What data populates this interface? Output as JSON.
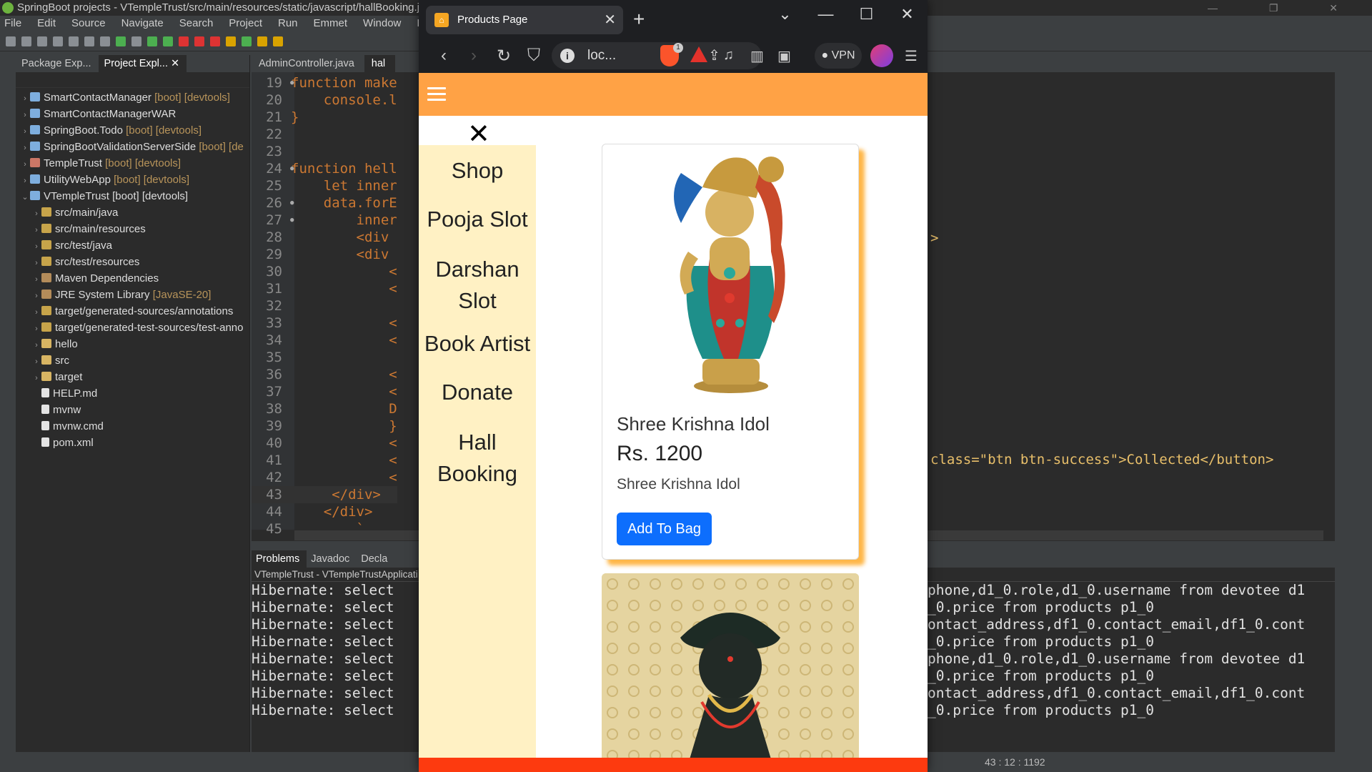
{
  "ide": {
    "title": "SpringBoot projects - VTempleTrust/src/main/resources/static/javascript/hallBooking.js - Sp",
    "menu": [
      "File",
      "Edit",
      "Source",
      "Navigate",
      "Search",
      "Project",
      "Run",
      "Emmet",
      "Window",
      "Help"
    ],
    "panel_tabs": [
      "Package Exp...",
      "Project Expl..."
    ],
    "tree": [
      {
        "name": "SmartContactManager",
        "dec": " [boot] [devtools]",
        "kind": "proj",
        "arrow": "›"
      },
      {
        "name": "SmartContactManagerWAR",
        "dec": "",
        "kind": "proj",
        "arrow": "›"
      },
      {
        "name": "SpringBoot.Todo",
        "dec": " [boot] [devtools]",
        "kind": "proj",
        "arrow": "›"
      },
      {
        "name": "SpringBootValidationServerSide",
        "dec": " [boot] [de",
        "kind": "proj",
        "arrow": "›"
      },
      {
        "name": "TempleTrust",
        "dec": " [boot] [devtools]",
        "kind": "proj err",
        "arrow": "›"
      },
      {
        "name": "UtilityWebApp",
        "dec": " [boot] [devtools]",
        "kind": "proj",
        "arrow": "›"
      },
      {
        "name": "VTempleTrust [boot] [devtools]",
        "dec": "",
        "kind": "proj",
        "arrow": "⌄"
      },
      {
        "name": "src/main/java",
        "dec": "",
        "kind": "src",
        "arrow": "›",
        "indent": 1
      },
      {
        "name": "src/main/resources",
        "dec": "",
        "kind": "src",
        "arrow": "›",
        "indent": 1
      },
      {
        "name": "src/test/java",
        "dec": "",
        "kind": "src",
        "arrow": "›",
        "indent": 1
      },
      {
        "name": "src/test/resources",
        "dec": "",
        "kind": "src",
        "arrow": "›",
        "indent": 1
      },
      {
        "name": "Maven Dependencies",
        "dec": "",
        "kind": "lib",
        "arrow": "›",
        "indent": 1
      },
      {
        "name": "JRE System Library",
        "dec": " [JavaSE-20]",
        "kind": "lib",
        "arrow": "›",
        "indent": 1
      },
      {
        "name": "target/generated-sources/annotations",
        "dec": "",
        "kind": "src",
        "arrow": "›",
        "indent": 1
      },
      {
        "name": "target/generated-test-sources/test-anno",
        "dec": "",
        "kind": "src",
        "arrow": "›",
        "indent": 1
      },
      {
        "name": "hello",
        "dec": "",
        "kind": "fold",
        "arrow": "›",
        "indent": 1
      },
      {
        "name": "src",
        "dec": "",
        "kind": "fold",
        "arrow": "›",
        "indent": 1
      },
      {
        "name": "target",
        "dec": "",
        "kind": "fold",
        "arrow": "›",
        "indent": 1
      },
      {
        "name": "HELP.md",
        "dec": "",
        "kind": "file",
        "arrow": "",
        "indent": 1
      },
      {
        "name": "mvnw",
        "dec": "",
        "kind": "file",
        "arrow": "",
        "indent": 1
      },
      {
        "name": "mvnw.cmd",
        "dec": "",
        "kind": "file",
        "arrow": "",
        "indent": 1
      },
      {
        "name": "pom.xml",
        "dec": "",
        "kind": "file",
        "arrow": "",
        "indent": 1
      }
    ],
    "editor_tabs": [
      "AdminController.java",
      "hal"
    ],
    "code_lines": [
      {
        "n": "19",
        "bp": true,
        "t": "function make"
      },
      {
        "n": "20",
        "bp": false,
        "t": "    console.l"
      },
      {
        "n": "21",
        "bp": false,
        "t": "}"
      },
      {
        "n": "22",
        "bp": false,
        "t": ""
      },
      {
        "n": "23",
        "bp": false,
        "t": ""
      },
      {
        "n": "24",
        "bp": true,
        "t": "function hell"
      },
      {
        "n": "25",
        "bp": false,
        "t": "    let inner"
      },
      {
        "n": "26",
        "bp": true,
        "t": "    data.forE"
      },
      {
        "n": "27",
        "bp": true,
        "t": "        inner"
      },
      {
        "n": "28",
        "bp": false,
        "t": "        <div "
      },
      {
        "n": "29",
        "bp": false,
        "t": "        <div "
      },
      {
        "n": "30",
        "bp": false,
        "t": "            <"
      },
      {
        "n": "31",
        "bp": false,
        "t": "            <"
      },
      {
        "n": "32",
        "bp": false,
        "t": ""
      },
      {
        "n": "33",
        "bp": false,
        "t": "            <"
      },
      {
        "n": "34",
        "bp": false,
        "t": "            <"
      },
      {
        "n": "35",
        "bp": false,
        "t": ""
      },
      {
        "n": "36",
        "bp": false,
        "t": "            <"
      },
      {
        "n": "37",
        "bp": false,
        "t": "            <"
      },
      {
        "n": "38",
        "bp": false,
        "t": "            D"
      },
      {
        "n": "39",
        "bp": false,
        "t": "            }"
      },
      {
        "n": "40",
        "bp": false,
        "t": "            <"
      },
      {
        "n": "41",
        "bp": false,
        "t": "            <"
      },
      {
        "n": "42",
        "bp": false,
        "t": "            <"
      },
      {
        "n": "43",
        "bp": false,
        "t": "     </div>"
      },
      {
        "n": "44",
        "bp": false,
        "t": "    </div>"
      },
      {
        "n": "45",
        "bp": false,
        "t": "        `"
      }
    ],
    "right_code": "class=\"btn btn-success\">Collected</button>",
    "right_code_mark": ">",
    "console_tabs": [
      "Problems",
      "Javadoc",
      "Decla"
    ],
    "console_title": "VTempleTrust - VTempleTrustApplicati",
    "console_lines": [
      "Hibernate: select",
      "Hibernate: select",
      "Hibernate: select",
      "Hibernate: select",
      "Hibernate: select",
      "Hibernate: select",
      "Hibernate: select",
      "Hibernate: select"
    ],
    "console_right": [
      "phone,d1_0.role,d1_0.username from devotee d1",
      "_0.price from products p1_0",
      "ontact_address,df1_0.contact_email,df1_0.cont",
      "_0.price from products p1_0",
      "phone,d1_0.role,d1_0.username from devotee d1",
      "_0.price from products p1_0",
      "ontact_address,df1_0.contact_email,df1_0.cont",
      "_0.price from products p1_0"
    ],
    "status_position": "43 : 12 : 1192"
  },
  "browser": {
    "tab_title": "Products Page",
    "url": "loc...",
    "vpn_label": "VPN",
    "brave_badge": "1"
  },
  "page": {
    "sidenav": [
      "Shop",
      "Pooja Slot",
      "Darshan Slot",
      "Book Artist",
      "Donate",
      "Hall Booking"
    ],
    "product": {
      "title": "Shree Krishna Idol",
      "price": "Rs. 1200",
      "description": "Shree Krishna Idol",
      "button": "Add To Bag"
    }
  }
}
